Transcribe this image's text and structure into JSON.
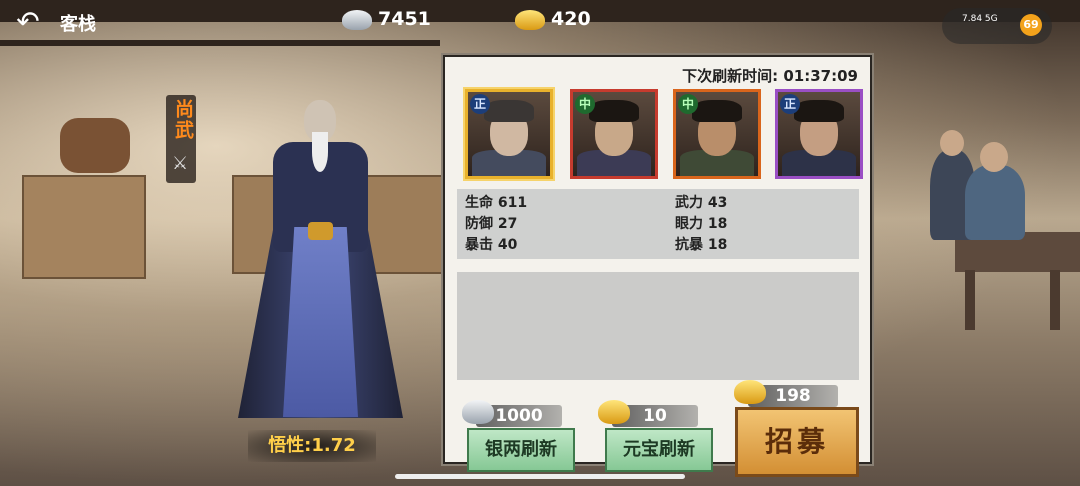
{
  "header": {
    "back_icon": "back-arrow-icon",
    "title": "客栈"
  },
  "resources": {
    "silver": "7451",
    "gold": "420"
  },
  "status_bar": {
    "signal": "7.84 5G",
    "battery": "69"
  },
  "npc": {
    "name": "尚武"
  },
  "hero": {
    "wisdom_label": "悟性:1.72"
  },
  "panel": {
    "timer_label": "下次刷新时间:",
    "timer_value": "01:37:09",
    "portraits": [
      {
        "tag": "正"
      },
      {
        "tag": "中"
      },
      {
        "tag": "中"
      },
      {
        "tag": "正"
      }
    ],
    "stats": {
      "hp": "生命 611",
      "def": "防御 27",
      "crit": "暴击 40",
      "atk": "武力 43",
      "eye": "眼力 18",
      "anticrit": "抗暴 18"
    }
  },
  "actions": {
    "silver_cost": "1000",
    "silver_refresh": "银两刷新",
    "gold_cost": "10",
    "gold_refresh": "元宝刷新",
    "recruit_cost": "198",
    "recruit": "招募"
  },
  "colors": {
    "accent_gold": "#ffcf4a",
    "button_green": "#86c895",
    "recruit_orange": "#d38f34"
  }
}
